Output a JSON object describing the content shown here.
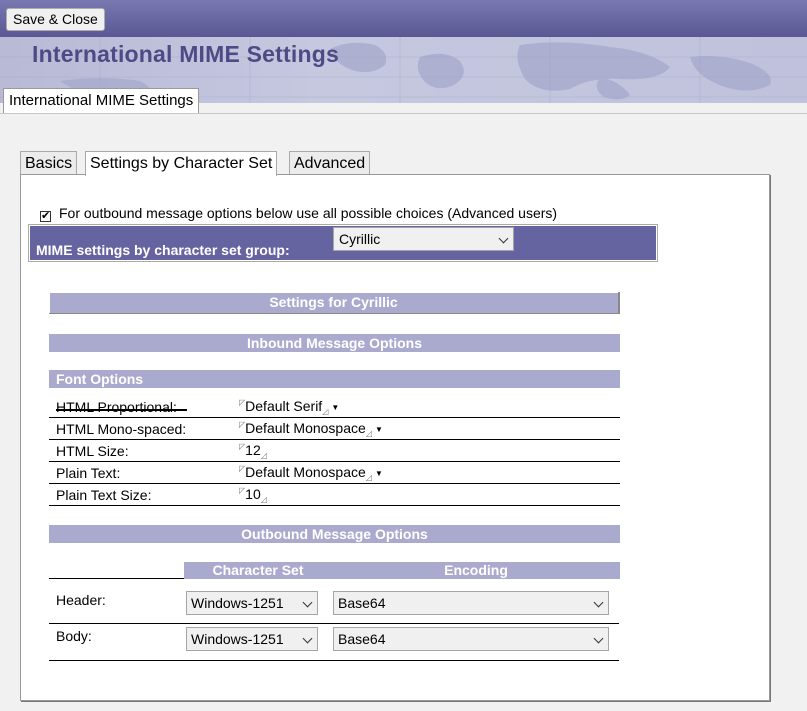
{
  "toolbar": {
    "save_close_label": "Save & Close"
  },
  "banner": {
    "title": "International MIME Settings"
  },
  "outer_tab": {
    "label": "International MIME Settings"
  },
  "tabs": [
    {
      "label": "Basics",
      "active": false
    },
    {
      "label": "Settings by Character Set",
      "active": true
    },
    {
      "label": "Advanced",
      "active": false
    }
  ],
  "advanced_option": {
    "checked": true,
    "checkmark": "✔",
    "label": "For outbound message options below use all possible choices (Advanced users)"
  },
  "group": {
    "label": "MIME settings by character set group:",
    "selected": "Cyrillic"
  },
  "section_title": "Settings for Cyrillic",
  "inbound": {
    "title": "Inbound Message Options",
    "font_options_title": "Font Options",
    "rows": [
      {
        "label": "HTML Proportional:",
        "value": "Default Serif",
        "dropdown": true
      },
      {
        "label": "HTML Mono-spaced:",
        "value": "Default Monospace",
        "dropdown": true
      },
      {
        "label": "HTML Size:",
        "value": "12",
        "dropdown": false
      },
      {
        "label": "Plain Text:",
        "value": "Default Monospace",
        "dropdown": true
      },
      {
        "label": "Plain Text Size:",
        "value": "10",
        "dropdown": false
      }
    ]
  },
  "outbound": {
    "title": "Outbound Message Options",
    "col_charset": "Character Set",
    "col_encoding": "Encoding",
    "rows": [
      {
        "label": "Header:",
        "charset": "Windows-1251",
        "encoding": "Base64"
      },
      {
        "label": "Body:",
        "charset": "Windows-1251",
        "encoding": "Base64"
      }
    ]
  },
  "colors": {
    "accent": "#6564a0",
    "header_band": "#aaaacf",
    "topbar": "#5a5894"
  }
}
